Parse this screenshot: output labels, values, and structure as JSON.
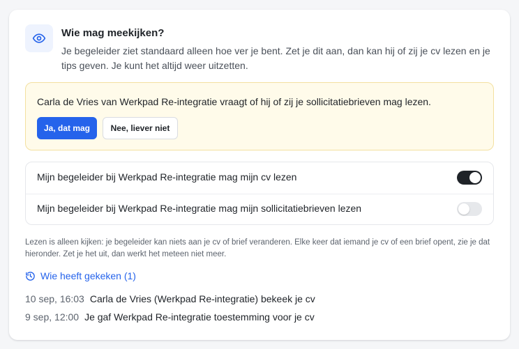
{
  "header": {
    "icon": "eye-icon",
    "title": "Wie mag meekijken?",
    "description": "Je begeleider ziet standaard alleen hoe ver je bent. Zet je dit aan, dan kan hij of zij je cv lezen en je tips geven. Je kunt het altijd weer uitzetten."
  },
  "request": {
    "text": "Carla de Vries van Werkpad Re-integratie vraagt of hij of zij je sollicitatiebrieven mag lezen.",
    "accept_label": "Ja, dat mag",
    "decline_label": "Nee, liever niet",
    "accent_color": "#2563eb",
    "background_color": "#fffbea"
  },
  "permissions": [
    {
      "label": "Mijn begeleider bij Werkpad Re-integratie mag mijn cv lezen",
      "enabled": true
    },
    {
      "label": "Mijn begeleider bij Werkpad Re-integratie mag mijn sollicitatiebrieven lezen",
      "enabled": false
    }
  ],
  "note": "Lezen is alleen kijken: je begeleider kan niets aan je cv of brief veranderen. Elke keer dat iemand je cv of een brief opent, zie je dat hieronder. Zet je het uit, dan werkt het meteen niet meer.",
  "history": {
    "icon": "history-icon",
    "link_label": "Wie heeft gekeken (1)",
    "entries": [
      {
        "time": "10 sep, 16:03",
        "text": "Carla de Vries (Werkpad Re-integratie) bekeek je cv"
      },
      {
        "time": "9 sep, 12:00",
        "text": "Je gaf Werkpad Re-integratie toestemming voor je cv"
      }
    ]
  }
}
